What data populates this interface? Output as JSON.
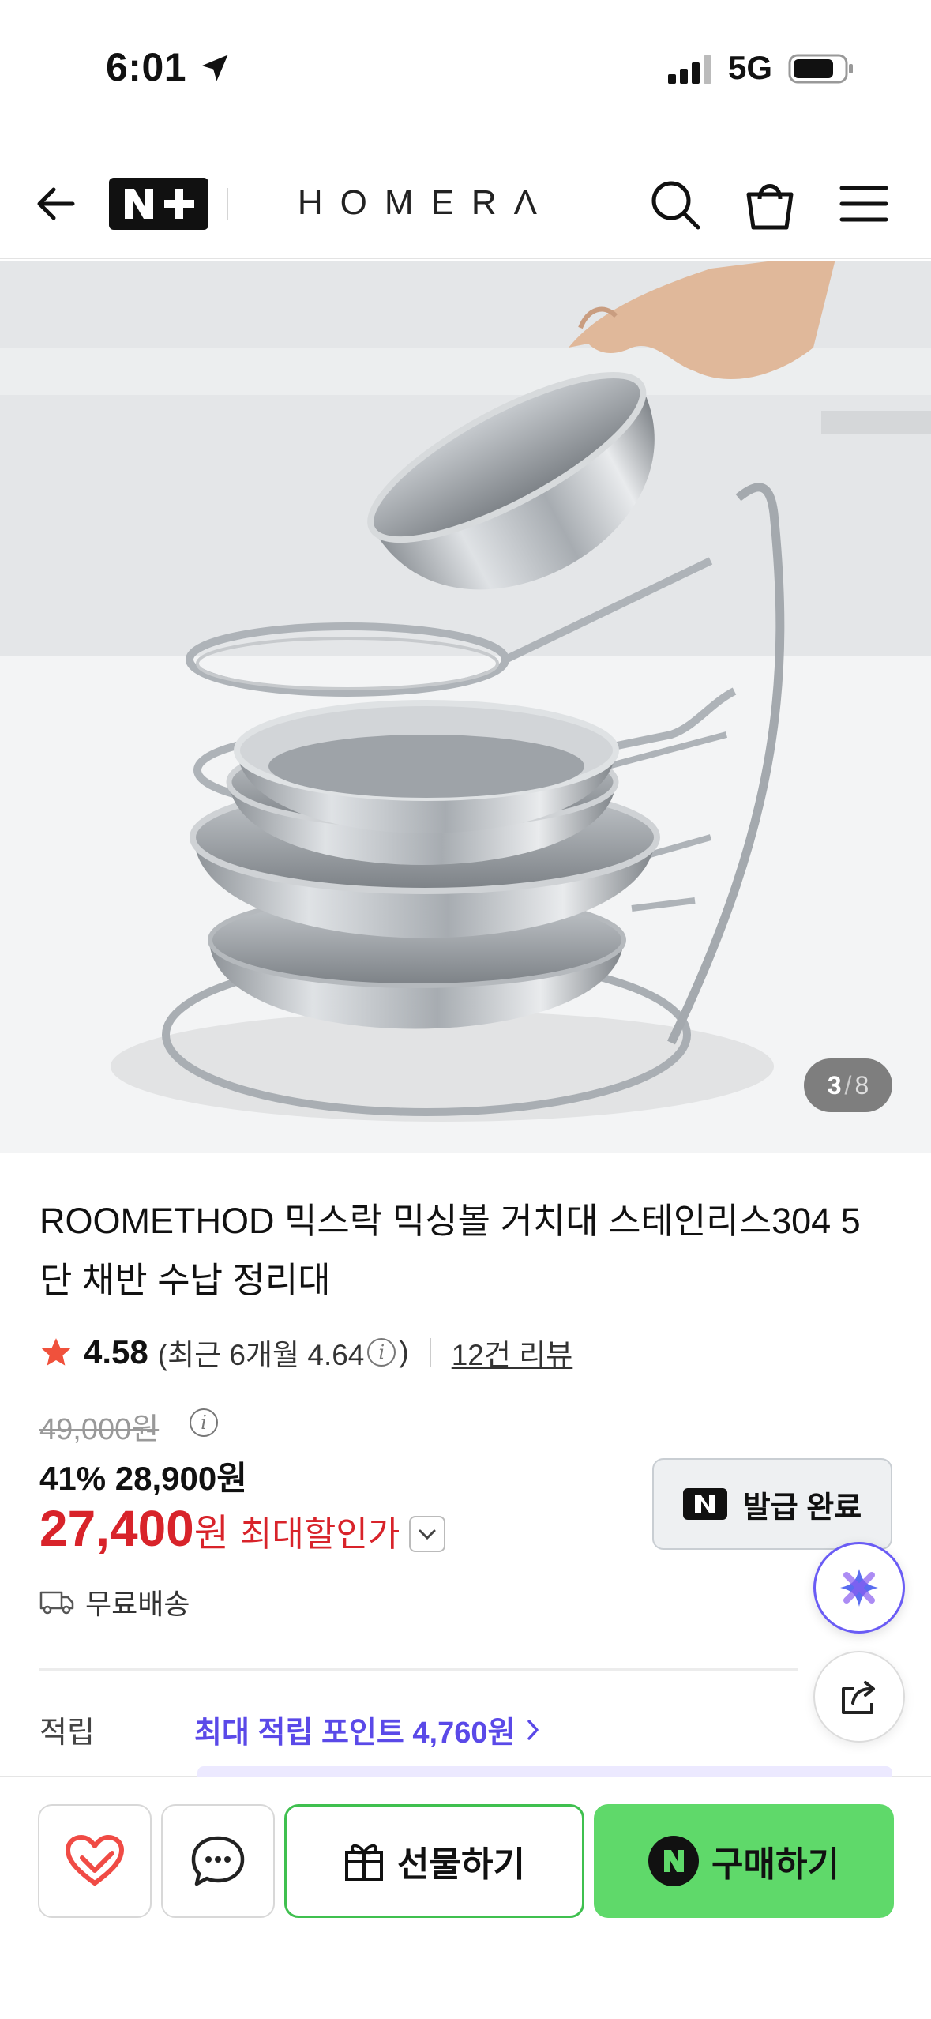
{
  "status_bar": {
    "time": "6:01",
    "network": "5G",
    "icons": [
      "location-arrow-icon",
      "cellular-signal-icon",
      "battery-icon"
    ]
  },
  "nav": {
    "back_icon": "back-arrow-icon",
    "badge": "N+",
    "brand": "HOMERΛ",
    "search_icon": "search-icon",
    "cart_icon": "shopping-bag-icon",
    "menu_icon": "hamburger-menu-icon"
  },
  "gallery": {
    "current": "3",
    "separator": "/",
    "total": "8"
  },
  "product": {
    "title": "ROOMETHOD 믹스락 믹싱볼 거치대 스테인리스304 5단 채반 수납 정리대",
    "rating": "4.58",
    "recent_open": "(최근 6개월 4.64",
    "recent_close": ")",
    "reviews": "12건 리뷰",
    "original_price": "49,000원",
    "discount": "41%",
    "sale_price": "28,900원",
    "final_price": "27,400",
    "final_unit": "원",
    "final_label": "최대할인가",
    "coupon_label": "발급 완료",
    "shipping": "무료배송",
    "points_label": "적립",
    "points_value": "최대 적립 포인트 4,760원"
  },
  "colors": {
    "price_red": "#d8232a",
    "points_purple": "#5a49e8",
    "buy_green": "#5fd96a",
    "gift_border": "#3fc04f",
    "star": "#f0513c"
  },
  "bottom_bar": {
    "wishlist_icon": "heart-icon",
    "chat_icon": "chat-bubble-icon",
    "gift_label": "선물하기",
    "buy_label": "구매하기"
  }
}
